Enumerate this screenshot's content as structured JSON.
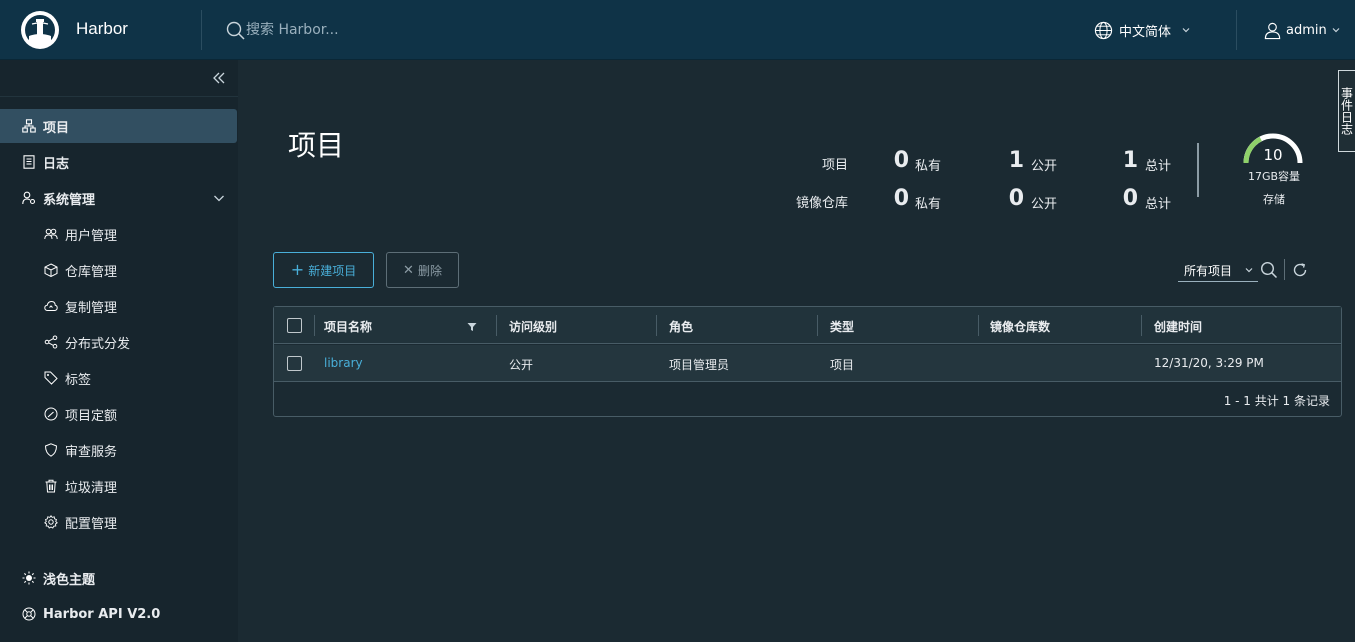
{
  "header": {
    "app_title": "Harbor",
    "search_placeholder": "搜索 Harbor...",
    "language": "中文简体",
    "user": "admin"
  },
  "sidebar": {
    "items": [
      {
        "label": "项目",
        "icon": "projects-icon",
        "active": true
      },
      {
        "label": "日志",
        "icon": "logs-icon"
      },
      {
        "label": "系统管理",
        "icon": "admin-icon",
        "expanded": true
      }
    ],
    "sub_items": [
      {
        "label": "用户管理",
        "icon": "users-icon"
      },
      {
        "label": "仓库管理",
        "icon": "box-icon"
      },
      {
        "label": "复制管理",
        "icon": "cloud-icon"
      },
      {
        "label": "分布式分发",
        "icon": "share-icon"
      },
      {
        "label": "标签",
        "icon": "tag-icon"
      },
      {
        "label": "项目定额",
        "icon": "dashboard-icon"
      },
      {
        "label": "审查服务",
        "icon": "shield-icon"
      },
      {
        "label": "垃圾清理",
        "icon": "trash-icon"
      },
      {
        "label": "配置管理",
        "icon": "gear-icon"
      }
    ],
    "bottom_items": [
      {
        "label": "浅色主题",
        "icon": "sun-icon"
      },
      {
        "label": "Harbor API V2.0",
        "icon": "api-icon"
      }
    ]
  },
  "main": {
    "title": "项目",
    "stats": {
      "rows": [
        {
          "label": "项目",
          "private": "0",
          "public": "1",
          "total": "1"
        },
        {
          "label": "镜像仓库",
          "private": "0",
          "public": "0",
          "total": "0"
        }
      ],
      "private_label": "私有",
      "public_label": "公开",
      "total_label": "总计"
    },
    "storage": {
      "value": "10",
      "caption": "17GB容量",
      "label": "存储",
      "fraction": 0.35,
      "accent": "#8fd16a"
    },
    "buttons": {
      "new_project": "新建项目",
      "delete": "删除"
    },
    "filter": {
      "selected": "所有项目"
    },
    "table": {
      "columns": [
        "项目名称",
        "访问级别",
        "角色",
        "类型",
        "镜像仓库数",
        "创建时间"
      ],
      "rows": [
        {
          "name": "library",
          "access": "公开",
          "role": "项目管理员",
          "type": "项目",
          "repo_count": "",
          "created": "12/31/20, 3:29 PM"
        }
      ],
      "footer": "1 - 1 共计 1 条记录"
    }
  },
  "side_tab": "事件日志",
  "colors": {
    "accent": "#49afd9",
    "header_bg": "#0f3347",
    "sidebar_bg": "#17252d",
    "main_bg": "#1b2a32"
  }
}
